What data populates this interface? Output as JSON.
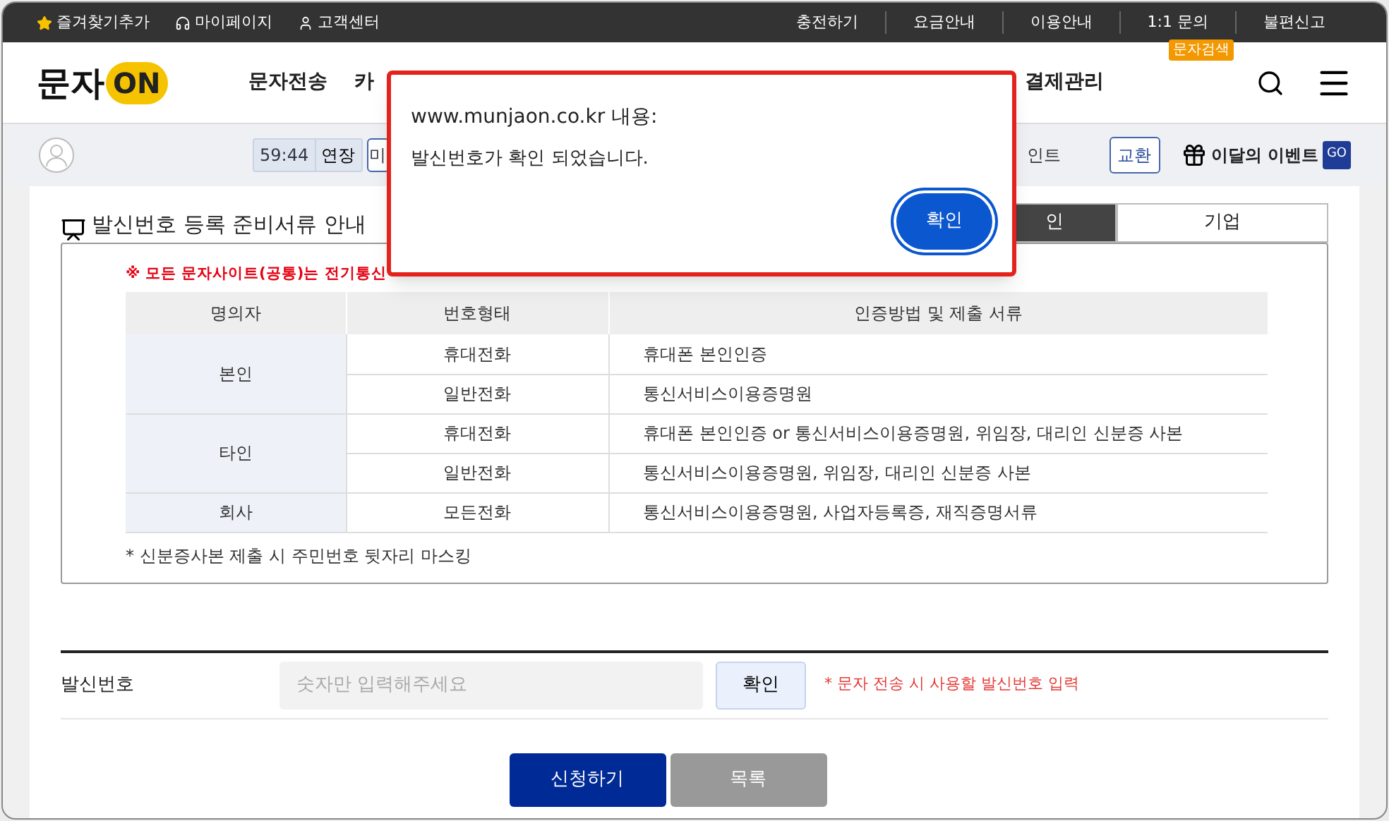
{
  "top_links": [
    "즐겨찾기추가",
    "마이페이지",
    "고객센터"
  ],
  "top_right_links": [
    "충전하기",
    "요금안내",
    "이용안내",
    "1:1 문의",
    "불편신고"
  ],
  "logo": {
    "text": "문자",
    "badge": "ON"
  },
  "nav": [
    "문자전송",
    "카",
    "결제관리"
  ],
  "search_badge": "문자검색",
  "toolbar": {
    "timer": "59:44",
    "extend": "연장",
    "cut_button": "미",
    "points": "인트",
    "exchange": "교환",
    "event": "이달의 이벤트",
    "event_badge": "GO"
  },
  "section": {
    "title": "발신번호 등록 준비서류 안내",
    "tabs": [
      {
        "label": "인",
        "selected": true
      },
      {
        "label": "기업",
        "selected": false
      }
    ]
  },
  "notice": "※ 모든 문자사이트(공통)는 전기통신",
  "table": {
    "columns": [
      "명의자",
      "번호형태",
      "인증방법 및 제출 서류"
    ],
    "groups": [
      {
        "owner": "본인",
        "rows": [
          {
            "type": "휴대전화",
            "docs": "휴대폰 본인인증"
          },
          {
            "type": "일반전화",
            "docs": "통신서비스이용증명원"
          }
        ]
      },
      {
        "owner": "타인",
        "rows": [
          {
            "type": "휴대전화",
            "docs": "휴대폰 본인인증 or 통신서비스이용증명원, 위임장, 대리인 신분증 사본"
          },
          {
            "type": "일반전화",
            "docs": "통신서비스이용증명원, 위임장, 대리인 신분증 사본"
          }
        ]
      },
      {
        "owner": "회사",
        "rows": [
          {
            "type": "모든전화",
            "docs": "통신서비스이용증명원, 사업자등록증, 재직증명서류"
          }
        ]
      }
    ]
  },
  "footnote": "* 신분증사본 제출 시 주민번호 뒷자리 마스킹",
  "form": {
    "label": "발신번호",
    "placeholder": "숫자만 입력해주세요",
    "check_button": "확인",
    "hint": "* 문자 전송 시 사용할 발신번호 입력"
  },
  "buttons": [
    {
      "label": "신청하기",
      "kind": "primary"
    },
    {
      "label": "목록",
      "kind": "secondary"
    }
  ],
  "dialog": {
    "title": "www.munjaon.co.kr 내용:",
    "message": "발신번호가 확인 되었습니다.",
    "button": "확인"
  }
}
